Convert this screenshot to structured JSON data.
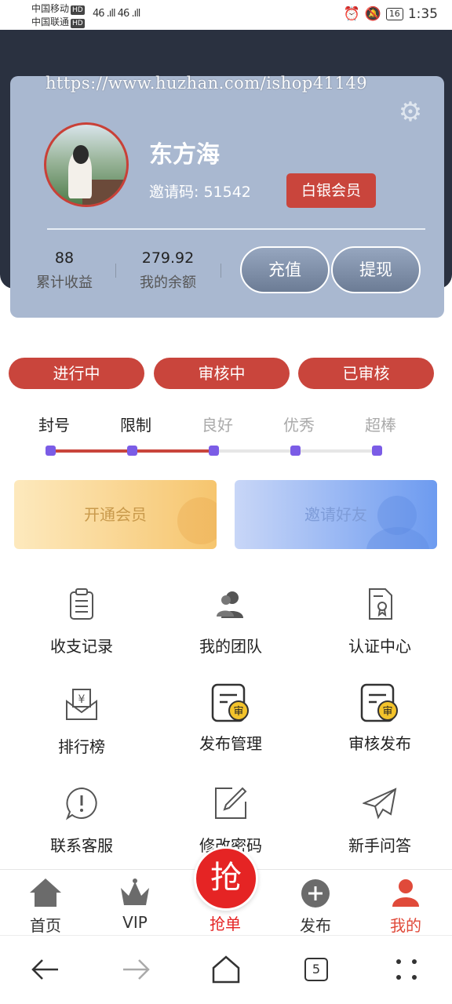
{
  "status_bar": {
    "carrier1": "中国移动",
    "carrier2": "中国联通",
    "hd": "HD",
    "signal": "46 .ıll 46 .ıll",
    "battery": "16",
    "time": "1:35"
  },
  "watermark": "https://www.huzhan.com/ishop41149",
  "profile": {
    "name": "东方海",
    "invite": "邀请码: 51542",
    "badge": "白银会员",
    "stats": [
      {
        "value": "88",
        "label": "累计收益"
      },
      {
        "value": "279.92",
        "label": "我的余额"
      }
    ],
    "recharge": "充值",
    "withdraw": "提现"
  },
  "tabs": [
    "进行中",
    "审核中",
    "已审核"
  ],
  "levels": {
    "labels": [
      "封号",
      "限制",
      "良好",
      "优秀",
      "超棒"
    ],
    "active_count": 3,
    "progress_fraction": 0.5
  },
  "promos": {
    "vip": "开通会员",
    "invite_friend": "邀请好友"
  },
  "grid": [
    {
      "label": "收支记录",
      "icon": "clipboard-icon"
    },
    {
      "label": "我的团队",
      "icon": "team-icon"
    },
    {
      "label": "认证中心",
      "icon": "certificate-icon"
    },
    {
      "label": "排行榜",
      "icon": "yuan-envelope-icon"
    },
    {
      "label": "发布管理",
      "icon": "audit-doc-icon"
    },
    {
      "label": "审核发布",
      "icon": "audit-doc-icon"
    },
    {
      "label": "联系客服",
      "icon": "exclamation-bubble-icon"
    },
    {
      "label": "修改密码",
      "icon": "edit-icon"
    },
    {
      "label": "新手问答",
      "icon": "paper-plane-icon"
    }
  ],
  "audit_glyph": "审",
  "bottom_nav": {
    "home": "首页",
    "vip": "VIP",
    "grab": "抢单",
    "grab_glyph": "抢",
    "publish": "发布",
    "mine": "我的"
  },
  "system_nav": {
    "tabs_count": "5"
  },
  "colors": {
    "accent": "#c9453c",
    "header": "#2a3140",
    "card": "#a9b8d0",
    "level_dot": "#7b5ce6",
    "grab": "#e52424"
  }
}
